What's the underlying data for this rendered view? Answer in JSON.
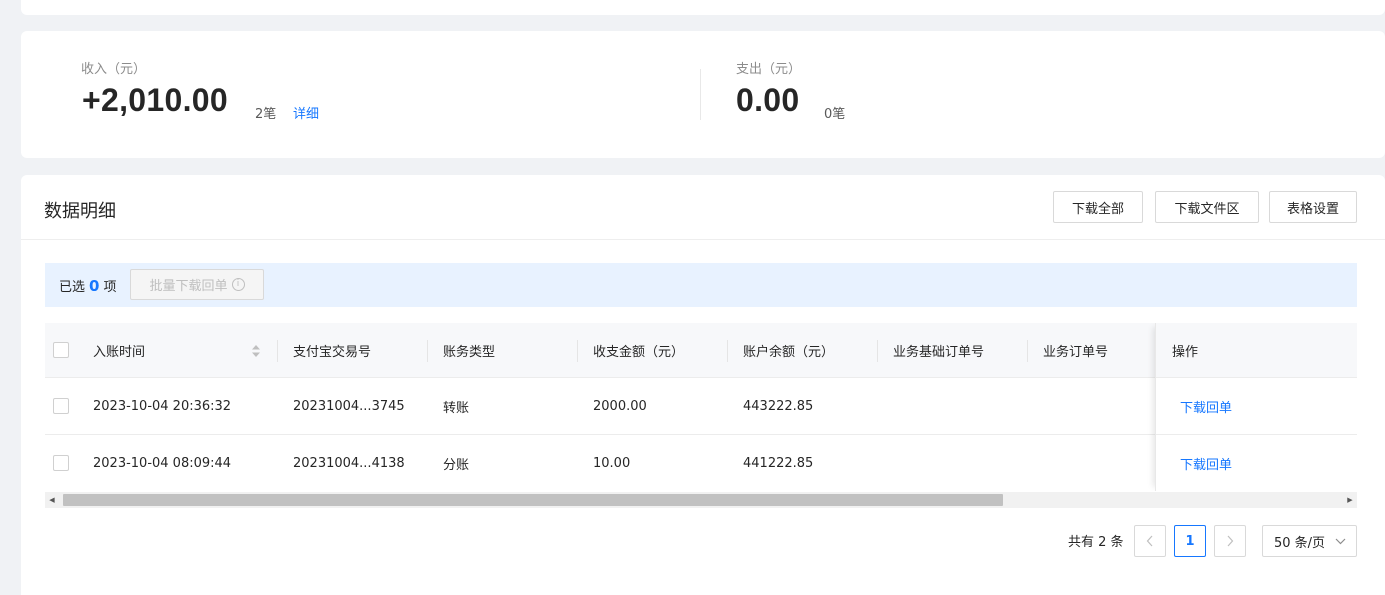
{
  "summary": {
    "income": {
      "label": "收入（元）",
      "amount": "+2,010.00",
      "count": "2笔",
      "detail_link": "详细"
    },
    "expense": {
      "label": "支出（元）",
      "amount": "0.00",
      "count": "0笔"
    }
  },
  "detail": {
    "title": "数据明细",
    "buttons": {
      "download_all": "下载全部",
      "download_area": "下载文件区",
      "table_settings": "表格设置"
    },
    "selection": {
      "prefix": "已选",
      "count": "0",
      "suffix": "项",
      "batch_button": "批量下载回单"
    },
    "columns": [
      "入账时间",
      "支付宝交易号",
      "账务类型",
      "收支金额（元）",
      "账户余额（元）",
      "业务基础订单号",
      "业务订单号",
      "操作"
    ],
    "rows": [
      {
        "time": "2023-10-04 20:36:32",
        "trade_no": "20231004...3745",
        "type": "转账",
        "amount": "2000.00",
        "balance": "443222.85",
        "base_order": "",
        "order": "",
        "action": "下载回单"
      },
      {
        "time": "2023-10-04 08:09:44",
        "trade_no": "20231004...4138",
        "type": "分账",
        "amount": "10.00",
        "balance": "441222.85",
        "base_order": "",
        "order": "",
        "action": "下载回单"
      }
    ],
    "pagination": {
      "total": "共有 2 条",
      "current_page": "1",
      "page_size": "50 条/页"
    }
  },
  "colors": {
    "accent": "#1677ff",
    "page_bg": "#f0f2f5",
    "selection_bg": "#e8f2ff"
  },
  "icons": {
    "sort": "sort-icon",
    "info": "info-icon",
    "prev": "chevron-left-icon",
    "next": "chevron-right-icon",
    "dropdown": "chevron-down-icon"
  }
}
